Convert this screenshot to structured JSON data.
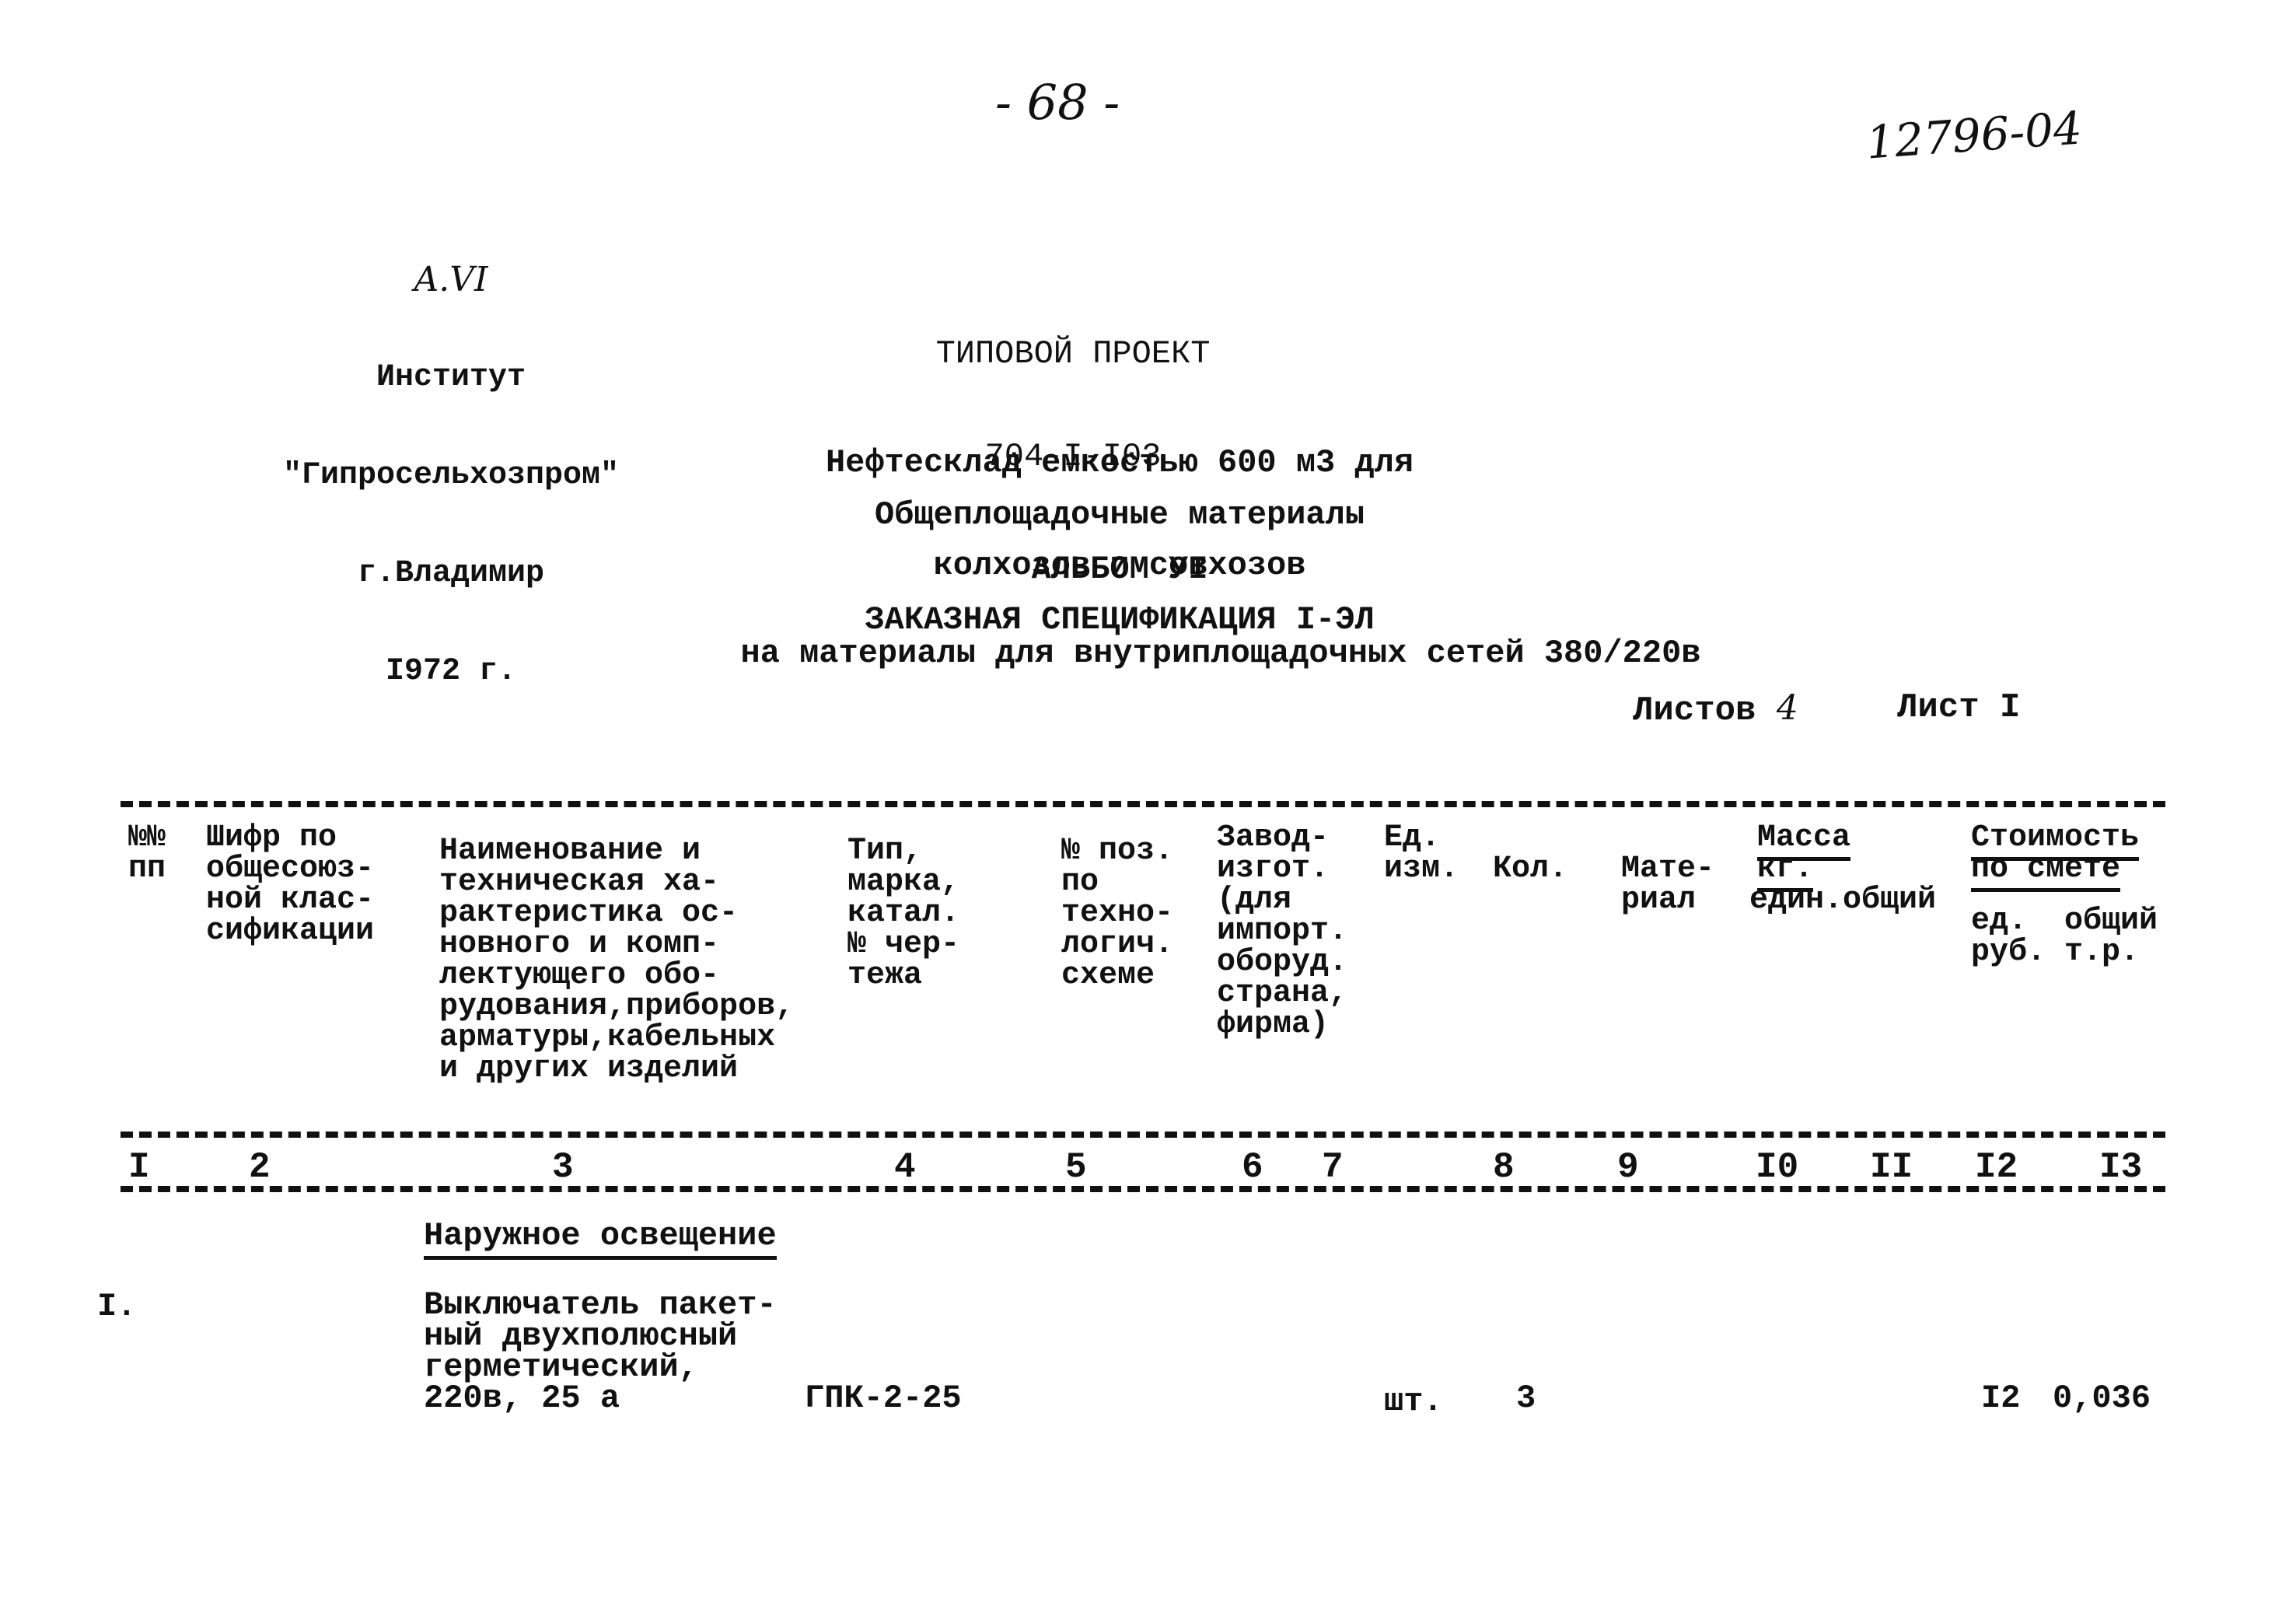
{
  "header": {
    "page_number": "- 68 -",
    "archive_number": "12796-04",
    "album_mark": "A.VI",
    "institute_lines": [
      "Институт",
      "\"Гипросельхозпром\"",
      "г.Владимир",
      "I972 г."
    ],
    "project_lines": [
      "ТИПОВОЙ ПРОЕКТ",
      "704-I-I03"
    ],
    "object_lines": [
      "Нефтесклад емкостью 600 м3 для",
      "колхозов и совхозов"
    ],
    "materials": "Общеплощадочные материалы",
    "album": "АЛЬБОМ УI",
    "spec_title": "ЗАКАЗНАЯ СПЕЦИФИКАЦИЯ I-ЭЛ",
    "spec_subtitle": "на материалы для внутриплощадочных сетей 380/220в",
    "sheets_total_label": "Листов",
    "sheets_total": "4",
    "sheet_label": "Лист",
    "sheet_number": "I"
  },
  "table": {
    "headers": [
      "№№\nпп",
      "Шифр по\nобщесоюз-\nной клас-\nсификации",
      "Наименование и\nтехническая ха-\nрактеристика ос-\nновного и комп-\nлектующего обо-\nрудования,приборов,\nарматуры,кабельных\nи других изделий",
      "Тип,\nмарка,\nкатал.\n№ чер-\nтежа",
      "№ поз.\nпо\nтехно-\nлогич.\nсхеме",
      "Завод-\nизгот.\n(для\nимпорт.\nоборуд.\nстрана,\nфирма)",
      "Ед.\nизм.",
      "Кол.",
      "Мате-\nриал",
      "Масса\nкг.",
      "един.общий",
      "Стоимость\nпо смете",
      "ед.  общий\nруб. т.р."
    ],
    "column_numbers": [
      "I",
      "2",
      "3",
      "4",
      "5",
      "6",
      "7",
      "8",
      "9",
      "I0",
      "II",
      "I2",
      "I3"
    ],
    "section_title": "Наружное освещение",
    "rows": [
      {
        "num": "I.",
        "code": "",
        "name": "Выключатель пакет-\nный двухполюсный\nгерметический,\n220в, 25 а",
        "type": "ГПК-2-25",
        "pos": "",
        "maker": "",
        "unit": "шт.",
        "qty": "3",
        "material": "",
        "mass_unit": "",
        "mass_total": "",
        "cost_unit": "I2",
        "cost_total": "0,036"
      }
    ]
  }
}
